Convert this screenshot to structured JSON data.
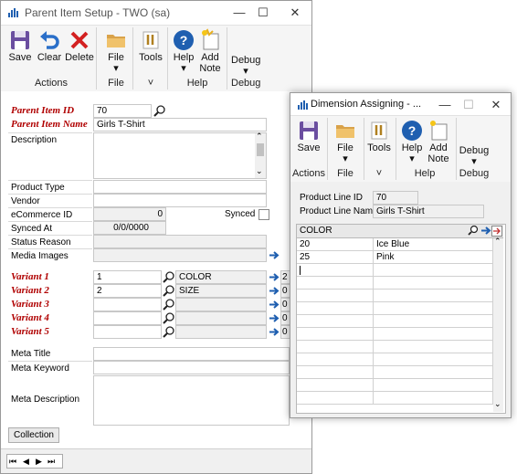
{
  "parent_window": {
    "title": "Parent Item Setup  -  TWO (sa)",
    "ribbon": {
      "save": "Save",
      "clear": "Clear",
      "delete": "Delete",
      "file": "File",
      "tools": "Tools",
      "help": "Help",
      "add_note": "Add Note",
      "debug": "Debug",
      "groups": {
        "actions": "Actions",
        "file": "File",
        "tools": "˅",
        "help": "Help",
        "debug": "Debug"
      }
    },
    "form": {
      "parent_item_id_label": "Parent Item ID",
      "parent_item_id_value": "70",
      "parent_item_name_label": "Parent Item Name",
      "parent_item_name_value": "Girls T-Shirt",
      "description_label": "Description",
      "product_type_label": "Product Type",
      "vendor_label": "Vendor",
      "ecommerce_id_label": "eCommerce ID",
      "ecommerce_id_value": "0",
      "synced_label": "Synced",
      "synced_at_label": "Synced At",
      "synced_at_value": "0/0/0000",
      "status_reason_label": "Status Reason",
      "media_images_label": "Media Images",
      "variants": [
        {
          "label": "Variant 1",
          "value": "1",
          "name": "COLOR",
          "count": "2"
        },
        {
          "label": "Variant 2",
          "value": "2",
          "name": "SIZE",
          "count": "0"
        },
        {
          "label": "Variant 3",
          "value": "",
          "name": "",
          "count": "0"
        },
        {
          "label": "Variant 4",
          "value": "",
          "name": "",
          "count": "0"
        },
        {
          "label": "Variant 5",
          "value": "",
          "name": "",
          "count": "0"
        }
      ],
      "meta_title_label": "Meta Title",
      "meta_keyword_label": "Meta Keyword",
      "meta_description_label": "Meta Description",
      "collection_button": "Collection"
    }
  },
  "dimension_window": {
    "title": "Dimension Assigning  -  ...",
    "ribbon": {
      "save": "Save",
      "file": "File",
      "tools": "Tools",
      "help": "Help",
      "add_note": "Add Note",
      "debug": "Debug",
      "groups": {
        "actions": "Actions",
        "file": "File",
        "tools": "˅",
        "help": "Help",
        "debug": "Debug"
      }
    },
    "product_line_id_label": "Product Line ID",
    "product_line_id_value": "70",
    "product_line_name_label": "Product Line Name",
    "product_line_name_value": "Girls T-Shirt",
    "grid_header": "COLOR",
    "rows": [
      {
        "code": "20",
        "name": "Ice Blue"
      },
      {
        "code": "25",
        "name": "Pink"
      }
    ]
  },
  "colors": {
    "accent": "#1f5fb0",
    "required": "#b00000",
    "ribbon_bg": "#f5f5f5"
  }
}
